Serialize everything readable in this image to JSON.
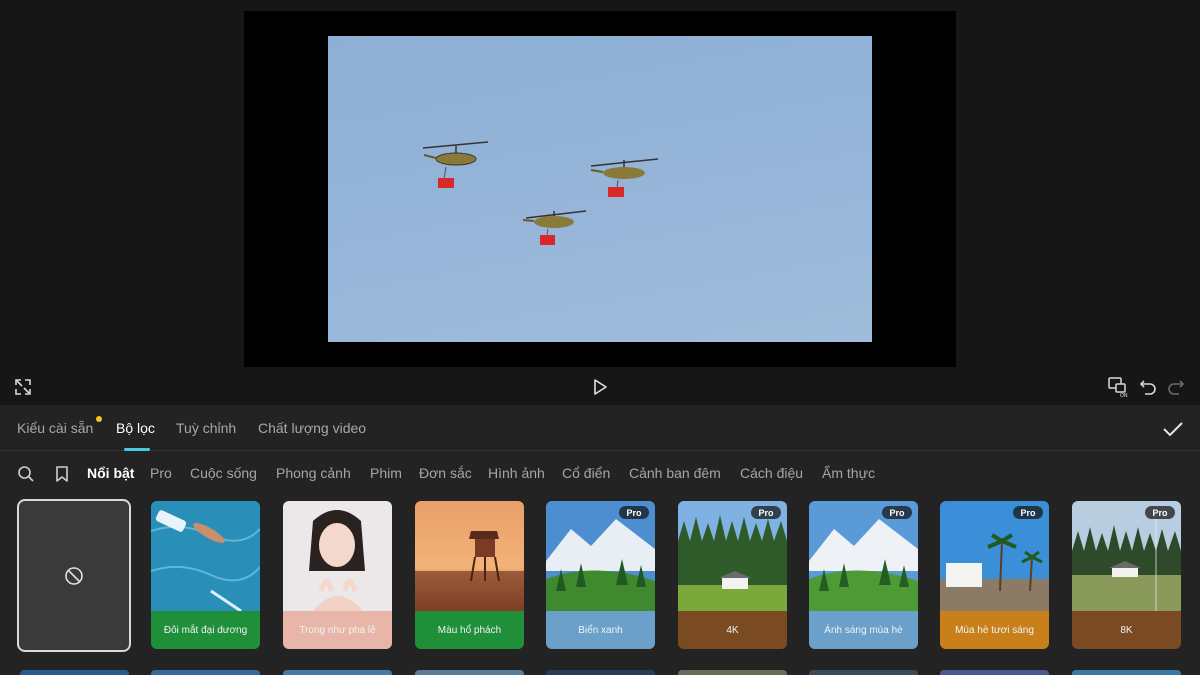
{
  "tabs": [
    {
      "label": "Kiểu cài sẵn"
    },
    {
      "label": "Bộ lọc"
    },
    {
      "label": "Tuỳ chỉnh"
    },
    {
      "label": "Chất lượng video"
    }
  ],
  "categories": [
    {
      "label": "Nổi bật"
    },
    {
      "label": "Pro"
    },
    {
      "label": "Cuộc sống"
    },
    {
      "label": "Phong cảnh"
    },
    {
      "label": "Phim"
    },
    {
      "label": "Đơn sắc"
    },
    {
      "label": "Hình ảnh"
    },
    {
      "label": "Cổ điển"
    },
    {
      "label": "Cảnh ban đêm"
    },
    {
      "label": "Cách điệu"
    },
    {
      "label": "Ẩm thực"
    }
  ],
  "filters": [
    {
      "label": "Đôi mắt đại dương",
      "pro": false,
      "label_color": "#1f8f3a"
    },
    {
      "label": "Trong như pha lê",
      "pro": false,
      "label_color": "#e8b6a8"
    },
    {
      "label": "Màu hổ phách",
      "pro": false,
      "label_color": "#1f8f3a"
    },
    {
      "label": "Biển xanh",
      "pro": true,
      "label_color": "#6aa0c9"
    },
    {
      "label": "4K",
      "pro": true,
      "label_color": "#7a4a22"
    },
    {
      "label": "Ánh sáng mùa hè",
      "pro": true,
      "label_color": "#6aa0c9"
    },
    {
      "label": "Mùa hè tươi sáng",
      "pro": true,
      "label_color": "#c9801a"
    },
    {
      "label": "8K",
      "pro": true,
      "label_color": "#7a4a22"
    }
  ],
  "pro_badge": "Pro",
  "icons": [
    "fullscreen-icon",
    "play-icon",
    "compare-icon",
    "undo-icon",
    "redo-icon",
    "checkmark-icon",
    "search-icon",
    "bookmark-icon",
    "no-filter-icon"
  ],
  "colors": {
    "accent": "#4bc9e4",
    "badge": "#f5c518",
    "background": "#1a1a1a",
    "panel": "#232323"
  }
}
